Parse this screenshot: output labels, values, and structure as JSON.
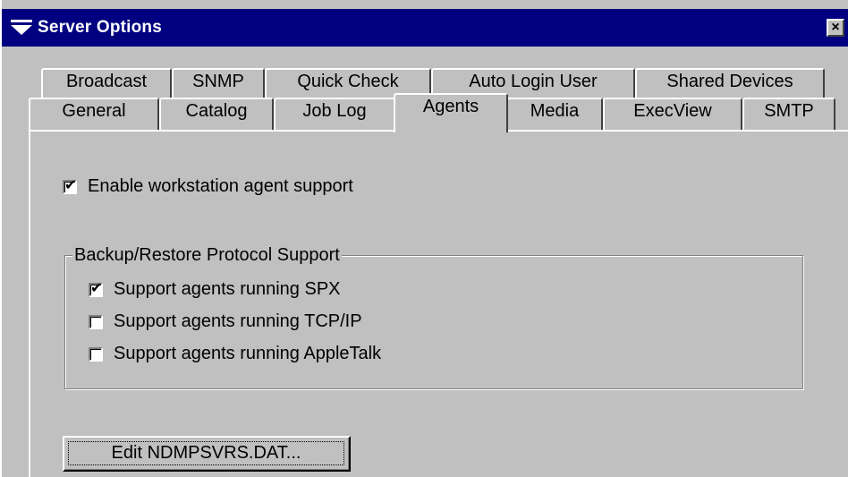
{
  "window": {
    "title": "Server Options",
    "close_symbol": "×"
  },
  "icons": {
    "title": "server-options-icon"
  },
  "tabs": {
    "row1": [
      "Broadcast",
      "SNMP",
      "Quick Check",
      "Auto Login User",
      "Shared Devices"
    ],
    "row2": [
      "General",
      "Catalog",
      "Job Log",
      "Agents",
      "Media",
      "ExecView",
      "SMTP"
    ],
    "active": "Agents"
  },
  "agents": {
    "enable_label": "Enable workstation agent support",
    "enable_checked": true,
    "group_title": "Backup/Restore Protocol Support",
    "options": [
      {
        "label": "Support agents running SPX",
        "checked": true
      },
      {
        "label": "Support agents running TCP/IP",
        "checked": false
      },
      {
        "label": "Support agents running AppleTalk",
        "checked": false
      }
    ],
    "edit_button": "Edit NDMPSVRS.DAT..."
  },
  "check_symbol": "✔"
}
